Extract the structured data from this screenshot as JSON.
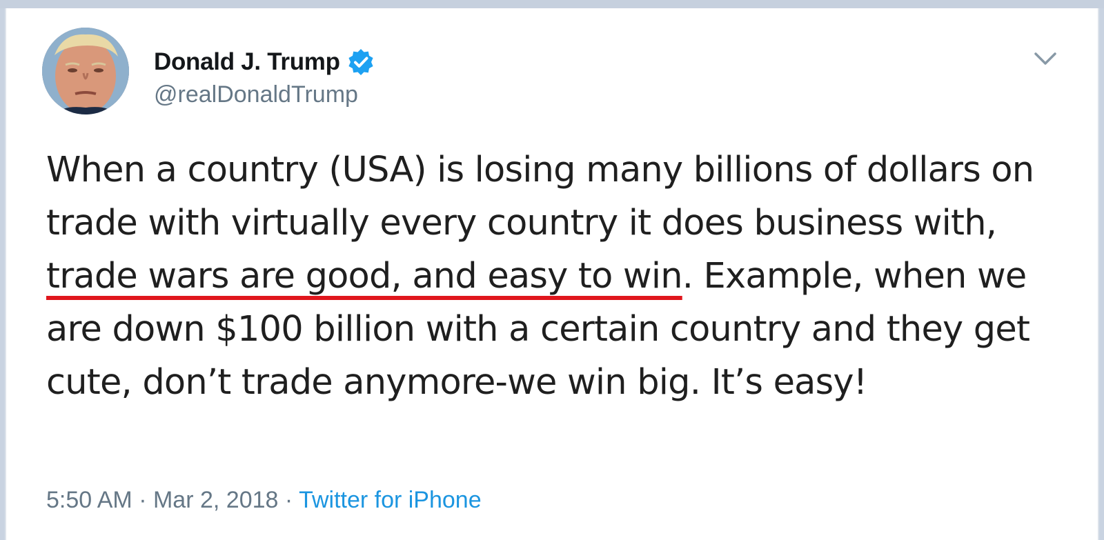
{
  "tweet": {
    "author": {
      "name": "Donald J. Trump",
      "handle": "@realDonaldTrump",
      "verified": true
    },
    "text_before": "When a country (USA) is losing many billions of dollars on trade with virtually every country it does business with, ",
    "text_highlighted": "trade wars are good, and easy to win",
    "text_after": ". Example, when we are down $100 billion with a certain country and they get cute, don’t trade anymore-we win big. It’s easy!",
    "time": "5:50 AM",
    "separator": "·",
    "date": "Mar 2, 2018",
    "source": "Twitter for iPhone"
  },
  "colors": {
    "highlight_underline": "#e0161d",
    "verified_badge": "#1da1f2",
    "link": "#1b95e0",
    "meta_text": "#657786"
  },
  "icons": {
    "verified": "verified-badge-icon",
    "menu": "chevron-down-icon"
  }
}
